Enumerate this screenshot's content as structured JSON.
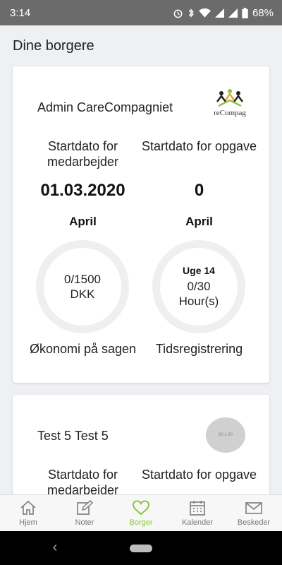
{
  "status_bar": {
    "time": "3:14",
    "battery": "68%"
  },
  "page_title": "Dine borgere",
  "cards": [
    {
      "name": "Admin CareCompagniet",
      "logo_text": "reCompag",
      "left_label": "Startdato for medarbejder",
      "right_label": "Startdato for opgave",
      "left_value": "01.03.2020",
      "right_value": "0",
      "left_month": "April",
      "right_month": "April",
      "economy_value": "0/1500",
      "economy_unit": "DKK",
      "week": "Uge 14",
      "hours_value": "0/30",
      "hours_unit": "Hour(s)",
      "economy_label": "Økonomi på sagen",
      "time_label": "Tidsregistrering"
    },
    {
      "name": "Test 5 Test 5",
      "avatar_placeholder": "80 x 80",
      "left_label": "Startdato for medarbeider",
      "right_label": "Startdato for opgave"
    }
  ],
  "bottom_nav": [
    {
      "label": "Hjem",
      "icon": "home-icon"
    },
    {
      "label": "Noter",
      "icon": "edit-icon"
    },
    {
      "label": "Borger",
      "icon": "heart-icon",
      "active": true
    },
    {
      "label": "Kalender",
      "icon": "calendar-icon"
    },
    {
      "label": "Beskeder",
      "icon": "mail-icon"
    }
  ],
  "colors": {
    "accent": "#8cc63f",
    "status_bar": "#6b6b6b",
    "ring": "#eef0ef"
  }
}
